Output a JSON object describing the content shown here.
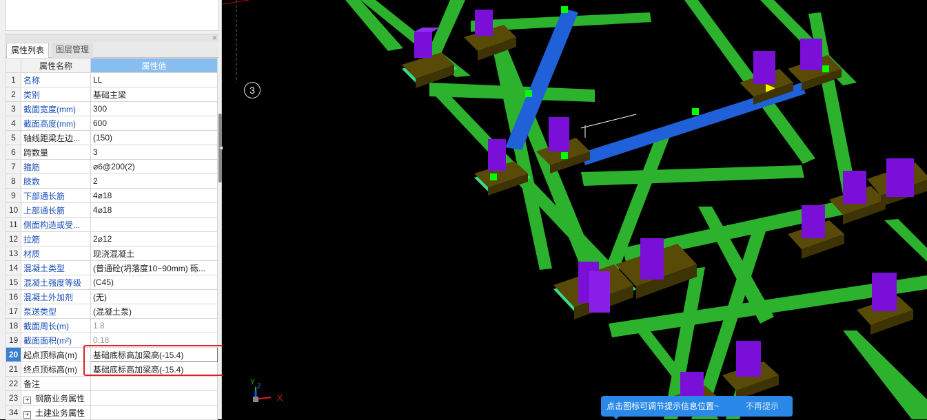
{
  "tabs": [
    "属性列表",
    "图层管理"
  ],
  "panel": {
    "close_label": "×"
  },
  "grid": {
    "header_name": "属性名称",
    "header_value": "属性值",
    "rows": [
      {
        "idx": "1",
        "name": "名称",
        "value": "LL",
        "name_color": "blue"
      },
      {
        "idx": "2",
        "name": "类别",
        "value": "基础主梁",
        "name_color": "blue"
      },
      {
        "idx": "3",
        "name": "截面宽度(mm)",
        "value": "300",
        "name_color": "blue"
      },
      {
        "idx": "4",
        "name": "截面高度(mm)",
        "value": "600",
        "name_color": "blue"
      },
      {
        "idx": "5",
        "name": "轴线距梁左边...",
        "value": "(150)",
        "name_color": "black"
      },
      {
        "idx": "6",
        "name": "跨数量",
        "value": "3",
        "name_color": "black"
      },
      {
        "idx": "7",
        "name": "箍筋",
        "value": "⌀6@200(2)",
        "name_color": "blue"
      },
      {
        "idx": "8",
        "name": "肢数",
        "value": "2",
        "name_color": "blue"
      },
      {
        "idx": "9",
        "name": "下部通长筋",
        "value": "4⌀18",
        "name_color": "blue"
      },
      {
        "idx": "10",
        "name": "上部通长筋",
        "value": "4⌀18",
        "name_color": "blue"
      },
      {
        "idx": "11",
        "name": "侧面构造或受...",
        "value": "",
        "name_color": "blue"
      },
      {
        "idx": "12",
        "name": "拉筋",
        "value": "2⌀12",
        "name_color": "blue"
      },
      {
        "idx": "13",
        "name": "材质",
        "value": "现浇混凝土",
        "name_color": "blue"
      },
      {
        "idx": "14",
        "name": "混凝土类型",
        "value": "(普通砼(坍落度10~90mm)  砾...",
        "name_color": "blue"
      },
      {
        "idx": "15",
        "name": "混凝土强度等级",
        "value": "(C45)",
        "name_color": "blue"
      },
      {
        "idx": "16",
        "name": "混凝土外加剂",
        "value": "(无)",
        "name_color": "blue"
      },
      {
        "idx": "17",
        "name": "泵送类型",
        "value": "(混凝土泵)",
        "name_color": "blue"
      },
      {
        "idx": "18",
        "name": "截面周长(m)",
        "value": "1.8",
        "name_color": "blue"
      },
      {
        "idx": "19",
        "name": "截面面积(m²)",
        "value": "0.18",
        "name_color": "blue"
      },
      {
        "idx": "20",
        "name": "起点顶标高(m)",
        "value": "基础底标高加梁高(-15.4)",
        "name_color": "black"
      },
      {
        "idx": "21",
        "name": "终点顶标高(m)",
        "value": "基础底标高加梁高(-15.4)",
        "name_color": "black"
      },
      {
        "idx": "22",
        "name": "备注",
        "value": "",
        "name_color": "black"
      },
      {
        "idx": "23",
        "name": "钢筋业务属性",
        "value": "",
        "name_color": "black"
      },
      {
        "idx": "34",
        "name": "土建业务属性",
        "value": "",
        "name_color": "black"
      }
    ]
  },
  "viewport": {
    "axis_marker": "3",
    "gizmo": {
      "x": "X",
      "y": "Y",
      "z": "Z"
    },
    "colors": {
      "background": "#000000",
      "beam_green": "#2db22d",
      "beam_blue": "#2060d8",
      "footing": "#5a4a08",
      "column": "#7a10d8",
      "grip": "#00ff00"
    }
  },
  "tip": {
    "text": "点击图标可调节提示信息位置~",
    "dismiss": "不再提示"
  }
}
